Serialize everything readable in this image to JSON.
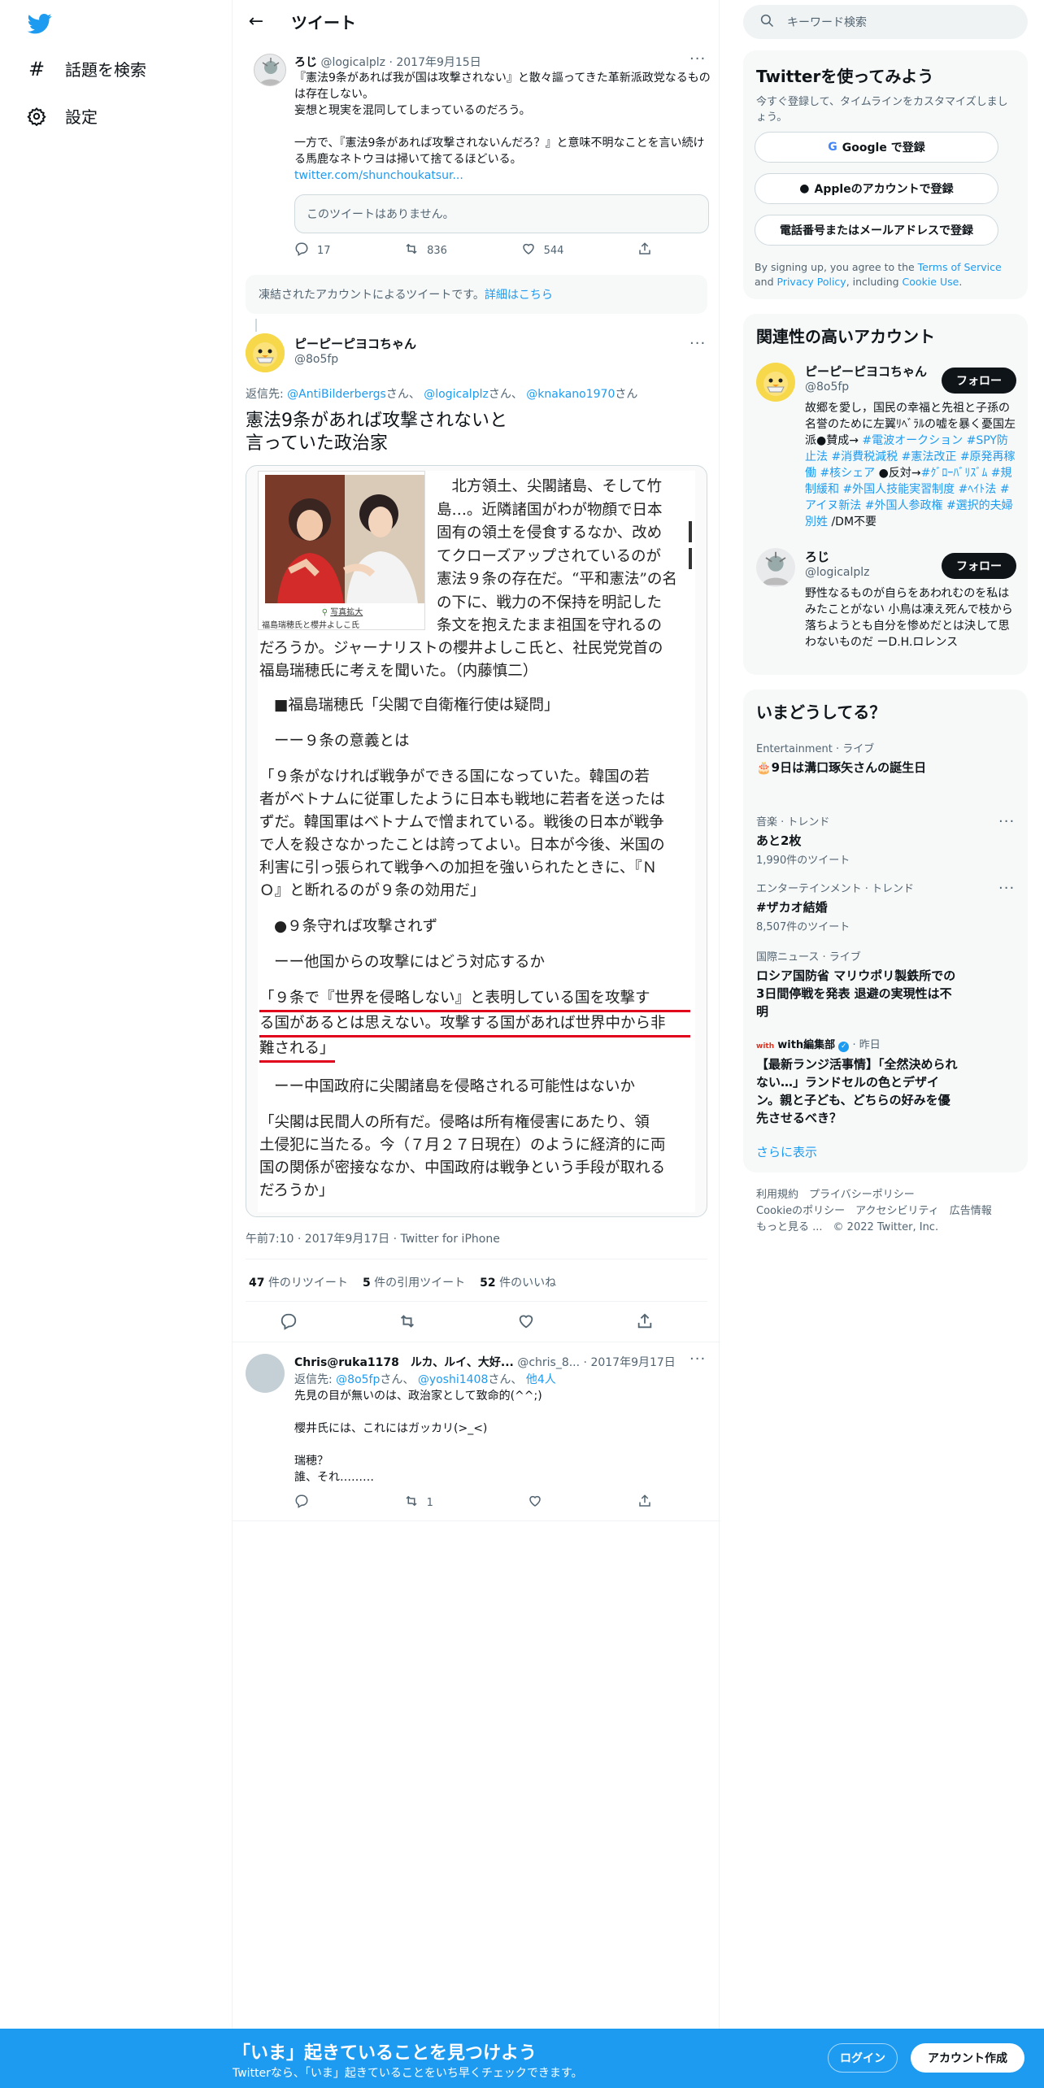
{
  "nav": {
    "explore_label": "話題を検索",
    "settings_label": "設定"
  },
  "header": {
    "title": "ツイート"
  },
  "quoted_parent": {
    "name": "ろじ",
    "handle": "@logicalplz",
    "date": "2017年9月15日",
    "text_lines": [
      "『憲法9条があれば我が国は攻撃されない』と散々謳ってきた革新派政党なるものは存在しない。",
      "妄想と現実を混同してしまっているのだろう。",
      "",
      "一方で、『憲法9条があれば攻撃されないんだろ？』と意味不明なことを言い続ける馬鹿なネトウヨは掃いて捨てるほどいる。"
    ],
    "link": "twitter.com/shunchoukatsur...",
    "unavailable": "このツイートはありません。",
    "replies": "17",
    "retweets": "836",
    "likes": "544"
  },
  "suspended_notice": {
    "text": "凍結されたアカウントによるツイートです。",
    "link": "詳細はこちら"
  },
  "main_tweet": {
    "name": "ピーピーピヨコちゃん",
    "handle": "@8o5fp",
    "reply_prefix": "返信先:",
    "reply_to": [
      "@AntiBilderbergs",
      "さん、",
      "@logicalplz",
      "さん、",
      "@knakano1970",
      "さん"
    ],
    "text_line1": "憲法9条があれば攻撃されないと",
    "text_line2": "言っていた政治家",
    "timestamp": "午前7:10 · 2017年9月17日 · Twitter for iPhone",
    "retweets_num": "47",
    "retweets_label": "件のリツイート",
    "quotes_num": "5",
    "quotes_label": "件の引用ツイート",
    "likes_num": "52",
    "likes_label": "件のいいね"
  },
  "article": {
    "photo_enlarge": "写真拡大",
    "photo_caption": "福島瑞穂氏と櫻井よしこ氏",
    "lead_lines": [
      "　北方領土、尖閣諸島、そして竹",
      "島…。近隣諸国がわが物顔で日本",
      "固有の領土を侵食するなか、改め",
      "てクローズアップされているのが",
      "憲法９条の存在だ。“平和憲法”の名",
      "の下に、戦力の不保持を明記した",
      "条文を抱えたまま祖国を守れるの"
    ],
    "lead_full": [
      "だろうか。ジャーナリストの櫻井よしこ氏と、社民党党首の",
      "福島瑞穂氏に考えを聞いた。（内藤慎二）"
    ],
    "h1": "■福島瑞穂氏「尖閣で自衛権行使は疑問」",
    "q1": "ーー９条の意義とは",
    "p1": [
      "「９条がなければ戦争ができる国になっていた。韓国の若",
      "者がベトナムに従軍したように日本も戦地に若者を送ったは",
      "ずだ。韓国軍はベトナムで憎まれている。戦後の日本が戦争",
      "で人を殺さなかったことは誇ってよい。日本が今後、米国の",
      "利害に引っ張られて戦争への加担を強いられたときに、『Ｎ",
      "Ｏ』と断れるのが９条の効用だ」"
    ],
    "h2": "●９条守れば攻撃されず",
    "q2": "ーー他国からの攻撃にはどう対応するか",
    "p2": [
      "「９条で『世界を侵略しない』と表明している国を攻撃す",
      "る国があるとは思えない。攻撃する国があれば世界中から非",
      "難される」"
    ],
    "q3": "ーー中国政府に尖閣諸島を侵略される可能性はないか",
    "p3": [
      "「尖閣は民間人の所有だ。侵略は所有権侵害にあたり、領",
      "土侵犯に当たる。今（７月２７日現在）のように経済的に両",
      "国の関係が密接ななか、中国政府は戦争という手段が取れる",
      "だろうか」"
    ]
  },
  "reply_tweet": {
    "name": "Chris@ruka1178　ルカ、ルイ、大好...",
    "handle": "@chris_8...",
    "date": "2017年9月17日",
    "reply_prefix": "返信先:",
    "reply_to_1": "@8o5fp",
    "san1": "さん、",
    "reply_to_2": "@yoshi1408",
    "san2": "さん、",
    "others": "他4人",
    "lines": [
      "先見の目が無いのは、政治家として致命的(^^;)",
      "",
      "櫻井氏には、これにはガッカリ(>_<)",
      "",
      "瑞穂？",
      "誰、それ………"
    ],
    "retweets": "1"
  },
  "search": {
    "placeholder": "キーワード検索"
  },
  "signup": {
    "title": "Twitterを使ってみよう",
    "subtitle": "今すぐ登録して、タイムラインをカスタマイズしましょう。",
    "google": "Google で登録",
    "apple": "Appleのアカウントで登録",
    "phone": "電話番号またはメールアドレスで登録",
    "terms_1": "By signing up, you agree to the ",
    "terms_link1": "Terms of Service",
    "terms_2": " and ",
    "terms_link2": "Privacy Policy",
    "terms_3": ", including ",
    "terms_link3": "Cookie Use",
    "terms_4": "."
  },
  "related": {
    "title": "関連性の高いアカウント",
    "follow": "フォロー",
    "accounts": [
      {
        "name": "ピーピーピヨコちゃん",
        "handle": "@8o5fp"
      },
      {
        "name": "ろじ",
        "handle": "@logicalplz",
        "bio": "野性なるものが自らをあわれむのを私はみたことがない 小鳥は凍え死んで枝から落ちようとも自分を惨めだとは決して思わないものだ ーD.H.ロレンス"
      }
    ],
    "bio1": [
      {
        "t": "故郷を愛し，国民の幸福と先祖と子孫の名誉のために左翼ﾘﾍﾞﾗﾙの嘘を暴く憂国左派●賛成→ ",
        "c": 0
      },
      {
        "t": "#電波オークション",
        "c": 1
      },
      {
        "t": " ",
        "c": 0
      },
      {
        "t": "#SPY防止法",
        "c": 1
      },
      {
        "t": " ",
        "c": 0
      },
      {
        "t": "#消費税減税",
        "c": 1
      },
      {
        "t": " ",
        "c": 0
      },
      {
        "t": "#憲法改正",
        "c": 1
      },
      {
        "t": " ",
        "c": 0
      },
      {
        "t": "#原発再稼働",
        "c": 1
      },
      {
        "t": " ",
        "c": 0
      },
      {
        "t": "#核シェア",
        "c": 1
      },
      {
        "t": " ●反対→",
        "c": 0
      },
      {
        "t": "#ｸﾞﾛｰﾊﾞﾘｽﾞﾑ",
        "c": 1
      },
      {
        "t": " ",
        "c": 0
      },
      {
        "t": "#規制緩和",
        "c": 1
      },
      {
        "t": " ",
        "c": 0
      },
      {
        "t": "#外国人技能実習制度",
        "c": 1
      },
      {
        "t": " ",
        "c": 0
      },
      {
        "t": "#ﾍｲﾄ法",
        "c": 1
      },
      {
        "t": " ",
        "c": 0
      },
      {
        "t": "#アイヌ新法",
        "c": 1
      },
      {
        "t": " ",
        "c": 0
      },
      {
        "t": "#外国人参政権",
        "c": 1
      },
      {
        "t": " ",
        "c": 0
      },
      {
        "t": "#選択的夫婦別姓",
        "c": 1
      },
      {
        "t": " /DM不要",
        "c": 0
      }
    ]
  },
  "trends": {
    "title": "いまどうしてる？",
    "items": [
      {
        "cat": "Entertainment · ライブ",
        "title": "🎂9日は溝口琢矢さんの誕生日"
      },
      {
        "cat": "音楽 · トレンド",
        "title": "あと2枚",
        "count": "1,990件のツイート"
      },
      {
        "cat": "エンターテインメント · トレンド",
        "title": "#ザカオ結婚",
        "count": "8,507件のツイート"
      },
      {
        "cat": "国際ニュース · ライブ",
        "title": "ロシア国防省 マリウポリ製鉄所での3日間停戦を発表 退避の実現性は不明"
      },
      {
        "cat_source": "with編集部",
        "cat_time": "· 昨日",
        "title": "【最新ランジ活事情】「全然決められない…」ランドセルの色とデザイン。親と子ども、どちらの好みを優先させるべき？"
      }
    ],
    "show_more": "さらに表示"
  },
  "footer_links": {
    "l1": "利用規約",
    "l2": "プライバシーポリシー",
    "l3": "Cookieのポリシー",
    "l4": "アクセシビリティ",
    "l5": "広告情報",
    "l6": "もっと見る ...",
    "l7": "© 2022 Twitter, Inc."
  },
  "bottom": {
    "headline": "「いま」起きていることを見つけよう",
    "sub": "Twitterなら、「いま」起きていることをいち早くチェックできます。",
    "login": "ログイン",
    "signup": "アカウント作成"
  },
  "colors": {
    "accent": "#1d9bf0",
    "underline": "#e0001b"
  }
}
